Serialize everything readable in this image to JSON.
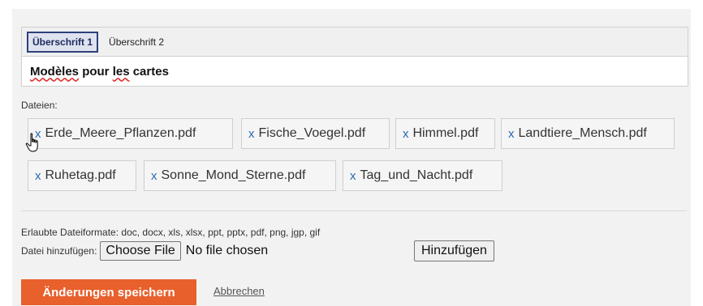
{
  "editor": {
    "toolbar": {
      "heading1": "Überschrift 1",
      "heading2": "Überschrift 2"
    },
    "content": {
      "word1": "Modèles",
      "word2": "pour",
      "word3": "les",
      "word4": "cartes"
    }
  },
  "files": {
    "label": "Dateien:",
    "remove_symbol": "x",
    "items": [
      "Erde_Meere_Pflanzen.pdf",
      "Fische_Voegel.pdf",
      "Himmel.pdf",
      "Landtiere_Mensch.pdf",
      "Ruhetag.pdf",
      "Sonne_Mond_Sterne.pdf",
      "Tag_und_Nacht.pdf"
    ]
  },
  "upload": {
    "formats_text": "Erlaubte Dateiformate: doc, docx, xls, xlsx, ppt, pptx, pdf, png, jgp, gif",
    "add_label": "Datei hinzufügen:",
    "choose_file": "Choose File",
    "no_file": "No file chosen",
    "add_button": "Hinzufügen"
  },
  "actions": {
    "save": "Änderungen speichern",
    "cancel": "Abbrechen"
  },
  "colors": {
    "accent": "#e8602c",
    "link": "#2a6ab0"
  },
  "icons": {
    "cursor": "hand-pointer-icon"
  }
}
